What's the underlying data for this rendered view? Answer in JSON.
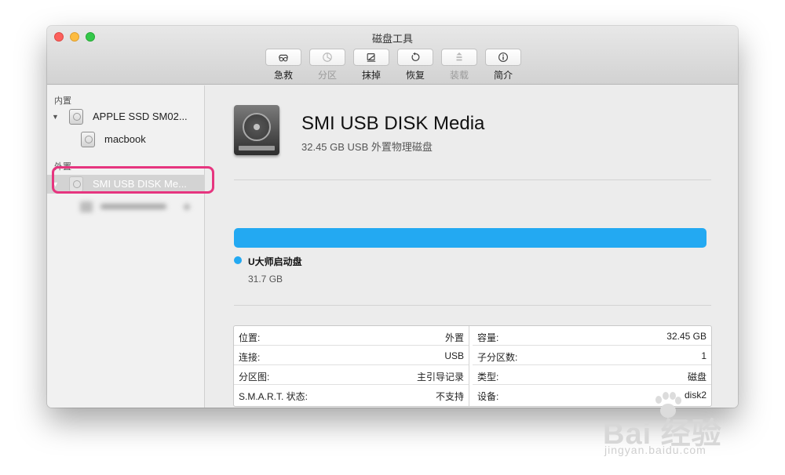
{
  "window": {
    "title": "磁盘工具"
  },
  "toolbar": [
    {
      "label": "急救",
      "icon": "first-aid-icon",
      "enabled": true
    },
    {
      "label": "分区",
      "icon": "partition-icon",
      "enabled": false
    },
    {
      "label": "抹掉",
      "icon": "erase-icon",
      "enabled": true
    },
    {
      "label": "恢复",
      "icon": "restore-icon",
      "enabled": true
    },
    {
      "label": "装载",
      "icon": "mount-icon",
      "enabled": false
    },
    {
      "label": "简介",
      "icon": "info-icon",
      "enabled": true
    }
  ],
  "sidebar": {
    "internal": {
      "header": "内置",
      "disk": "APPLE SSD SM02...",
      "volumes": [
        "macbook"
      ]
    },
    "external": {
      "header": "外置",
      "disk": "SMI USB DISK Me...",
      "selected": true
    }
  },
  "main": {
    "disk_name": "SMI USB DISK Media",
    "disk_subtitle": "32.45 GB USB 外置物理磁盘",
    "partition": {
      "name": "U大师启动盘",
      "size": "31.7 GB",
      "fill": 1.0,
      "color": "#23a9f2"
    },
    "info_left": [
      {
        "key": "位置:",
        "value": "外置"
      },
      {
        "key": "连接:",
        "value": "USB"
      },
      {
        "key": "分区图:",
        "value": "主引导记录"
      },
      {
        "key": "S.M.A.R.T. 状态:",
        "value": "不支持"
      }
    ],
    "info_right": [
      {
        "key": "容量:",
        "value": "32.45 GB"
      },
      {
        "key": "子分区数:",
        "value": "1"
      },
      {
        "key": "类型:",
        "value": "磁盘"
      },
      {
        "key": "设备:",
        "value": "disk2"
      }
    ]
  },
  "watermark": {
    "main": "Bai 经验",
    "sub": "jingyan.baidu.com"
  },
  "colors": {
    "accent": "#23a9f2",
    "highlight": "#e6357f"
  }
}
